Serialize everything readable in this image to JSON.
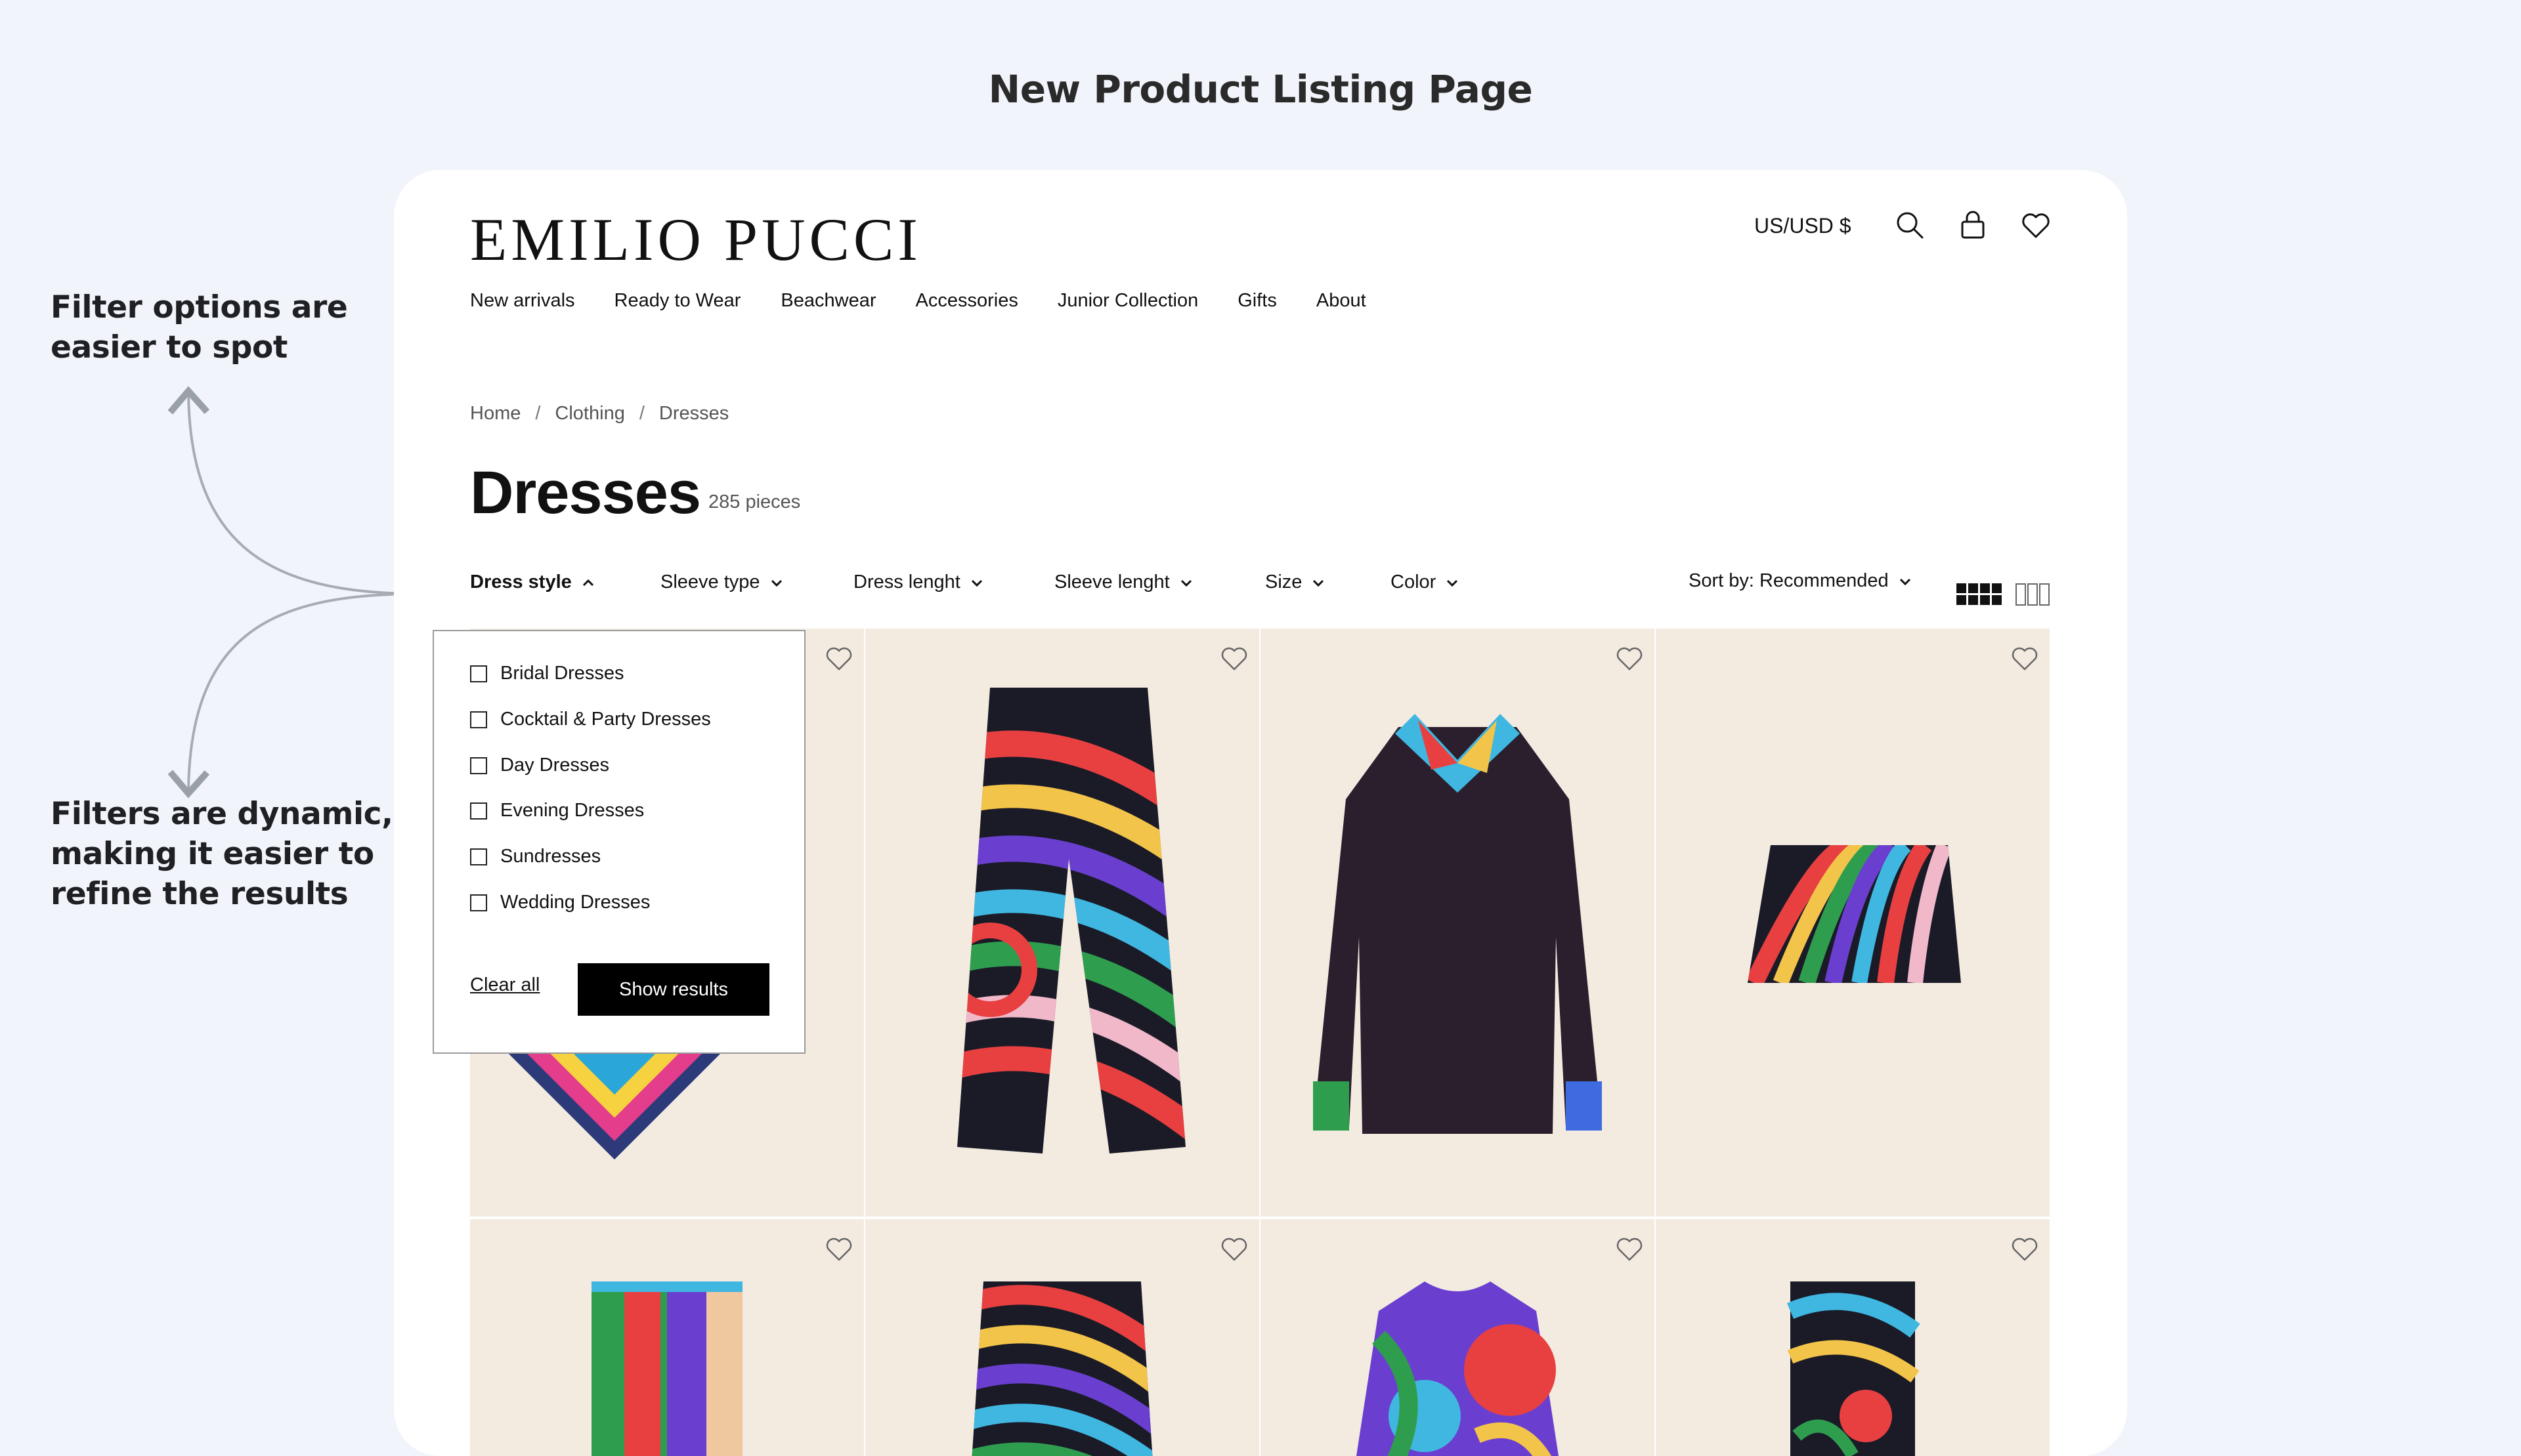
{
  "slide": {
    "title": "New Product Listing Page",
    "annotation_1": "Filter options are easier to spot",
    "annotation_2": "Filters are dynamic, making it easier to refine the results"
  },
  "header": {
    "logo": "EMILIO PUCCI",
    "currency": "US/USD $",
    "icons": [
      "search-icon",
      "bag-icon",
      "heart-icon"
    ]
  },
  "nav": {
    "items": [
      "New arrivals",
      "Ready to Wear",
      "Beachwear",
      "Accessories",
      "Junior Collection",
      "Gifts",
      "About"
    ]
  },
  "breadcrumb": [
    "Home",
    "Clothing",
    "Dresses"
  ],
  "breadcrumb_separator": "/",
  "listing": {
    "title": "Dresses",
    "count": "285 pieces"
  },
  "filters": [
    {
      "label": "Dress style",
      "open": true
    },
    {
      "label": "Sleeve type",
      "open": false
    },
    {
      "label": "Dress lenght",
      "open": false
    },
    {
      "label": "Sleeve lenght",
      "open": false
    },
    {
      "label": "Size",
      "open": false
    },
    {
      "label": "Color",
      "open": false
    }
  ],
  "sort": {
    "label": "Sort by: Recommended"
  },
  "view_toggle": [
    "grid-4-icon",
    "grid-3-icon"
  ],
  "dropdown": {
    "options": [
      "Bridal Dresses",
      "Cocktail & Party Dresses",
      "Day Dresses",
      "Evening Dresses",
      "Sundresses",
      "Wedding Dresses"
    ],
    "clear_label": "Clear all",
    "submit_label": "Show results"
  },
  "colors": {
    "page_bg": "#f1f4fb",
    "tile_bg": "#f3ebe0",
    "button_bg": "#000000"
  }
}
